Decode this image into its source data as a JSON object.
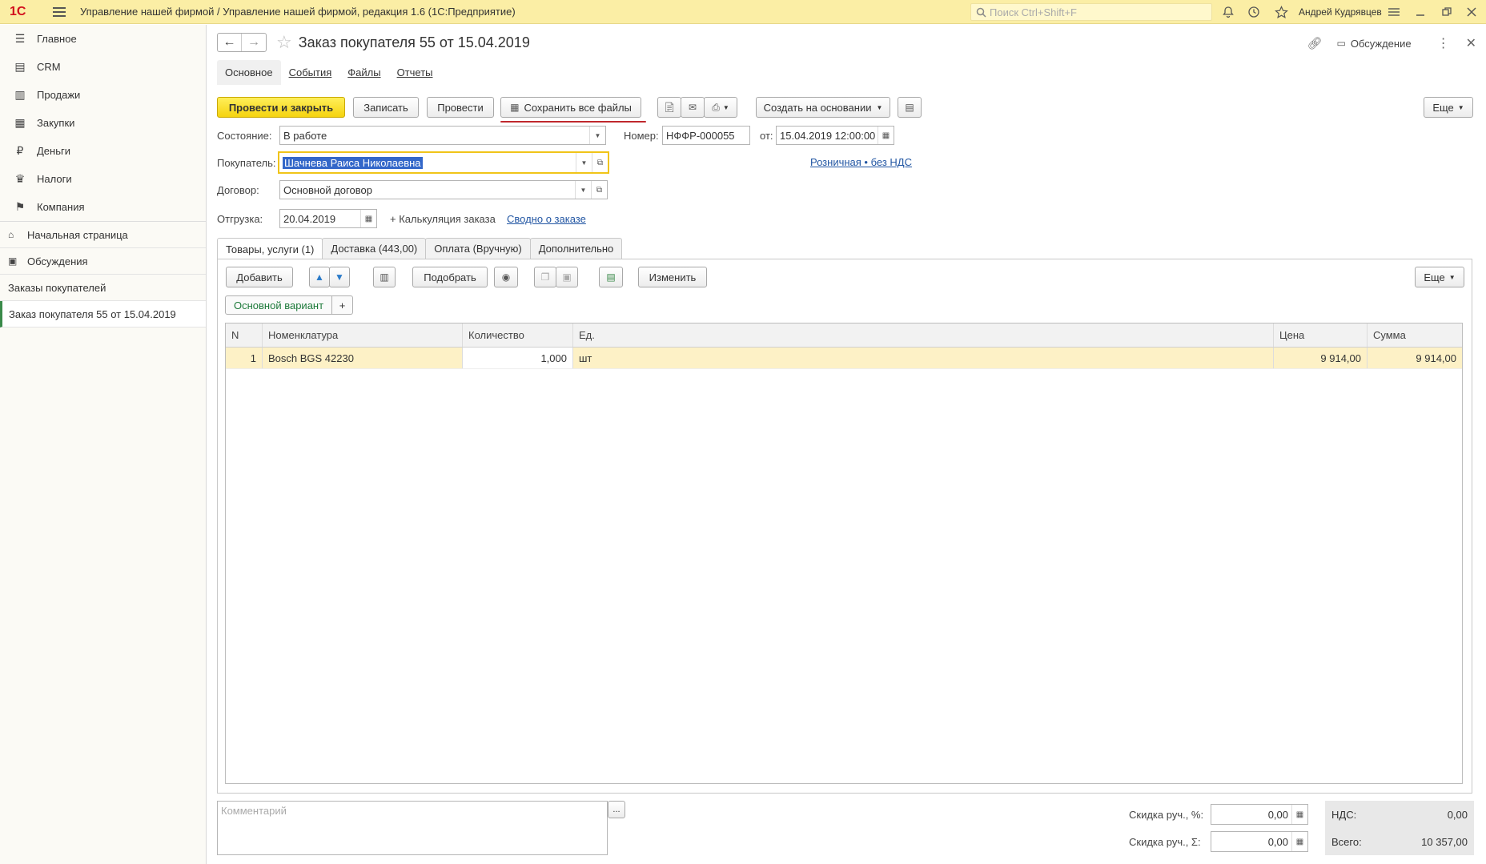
{
  "titlebar": {
    "logo": "1С",
    "title": "Управление нашей фирмой / Управление нашей фирмой, редакция 1.6  (1С:Предприятие)",
    "search_placeholder": "Поиск Ctrl+Shift+F",
    "user": "Андрей Кудрявцев"
  },
  "sidebar": {
    "sections": [
      {
        "label": "Главное",
        "icon": "menu-lines-icon"
      },
      {
        "label": "CRM",
        "icon": "crm-icon"
      },
      {
        "label": "Продажи",
        "icon": "sales-icon"
      },
      {
        "label": "Закупки",
        "icon": "purchases-icon"
      },
      {
        "label": "Деньги",
        "icon": "money-icon"
      },
      {
        "label": "Налоги",
        "icon": "taxes-icon"
      },
      {
        "label": "Компания",
        "icon": "flag-icon"
      }
    ],
    "open": [
      {
        "label": "Начальная страница",
        "icon": "home-icon"
      },
      {
        "label": "Обсуждения",
        "icon": "chat-icon"
      },
      {
        "label": "Заказы покупателей"
      },
      {
        "label": "Заказ покупателя 55 от 15.04.2019"
      }
    ]
  },
  "header": {
    "title": "Заказ покупателя 55 от 15.04.2019",
    "discussion": "Обсуждение"
  },
  "tabs_top": [
    "Основное",
    "События",
    "Файлы",
    "Отчеты"
  ],
  "toolbar": {
    "post_close": "Провести и закрыть",
    "save": "Записать",
    "post": "Провести",
    "save_all_files": "Сохранить все файлы",
    "create_based": "Создать на основании",
    "more": "Еще"
  },
  "form": {
    "state_label": "Состояние:",
    "state_value": "В работе",
    "number_label": "Номер:",
    "number_value": "НФФР-000055",
    "from_label": "от:",
    "date_value": "15.04.2019 12:00:00",
    "buyer_label": "Покупатель:",
    "buyer_value": "Шачнева Раиса Николаевна",
    "price_link": "Розничная • без НДС",
    "contract_label": "Договор:",
    "contract_value": "Основной договор",
    "shipping_label": "Отгрузка:",
    "shipping_value": "20.04.2019",
    "calc_label": "+ Калькуляция заказа",
    "summary_link": "Сводно о заказе"
  },
  "tabs_inner": [
    "Товары, услуги (1)",
    "Доставка (443,00)",
    "Оплата (Вручную)",
    "Дополнительно"
  ],
  "inner_toolbar": {
    "add": "Добавить",
    "pick": "Подобрать",
    "change": "Изменить",
    "more": "Еще",
    "variant": "Основной вариант",
    "variant_add": "+"
  },
  "table": {
    "columns": [
      "N",
      "Номенклатура",
      "Количество",
      "Ед.",
      "Цена",
      "Сумма"
    ],
    "rows": [
      {
        "n": "1",
        "nom": "Bosch BGS 42230",
        "qty": "1,000",
        "unit": "шт",
        "price": "9 914,00",
        "sum": "9 914,00"
      }
    ]
  },
  "footer": {
    "comment_placeholder": "Комментарий",
    "comment_btn": "...",
    "discount_pct_label": "Скидка руч., %:",
    "discount_pct_value": "0,00",
    "discount_sum_label": "Скидка руч., Σ:",
    "discount_sum_value": "0,00",
    "vat_label": "НДС:",
    "vat_value": "0,00",
    "total_label": "Всего:",
    "total_value": "10 357,00"
  },
  "colors": {
    "titlebar_bg": "#fbeea5",
    "primary_button": "#f5d30f",
    "selected_row": "#fdf1c6",
    "link": "#2256a3",
    "annotation_red": "#c0282d"
  }
}
